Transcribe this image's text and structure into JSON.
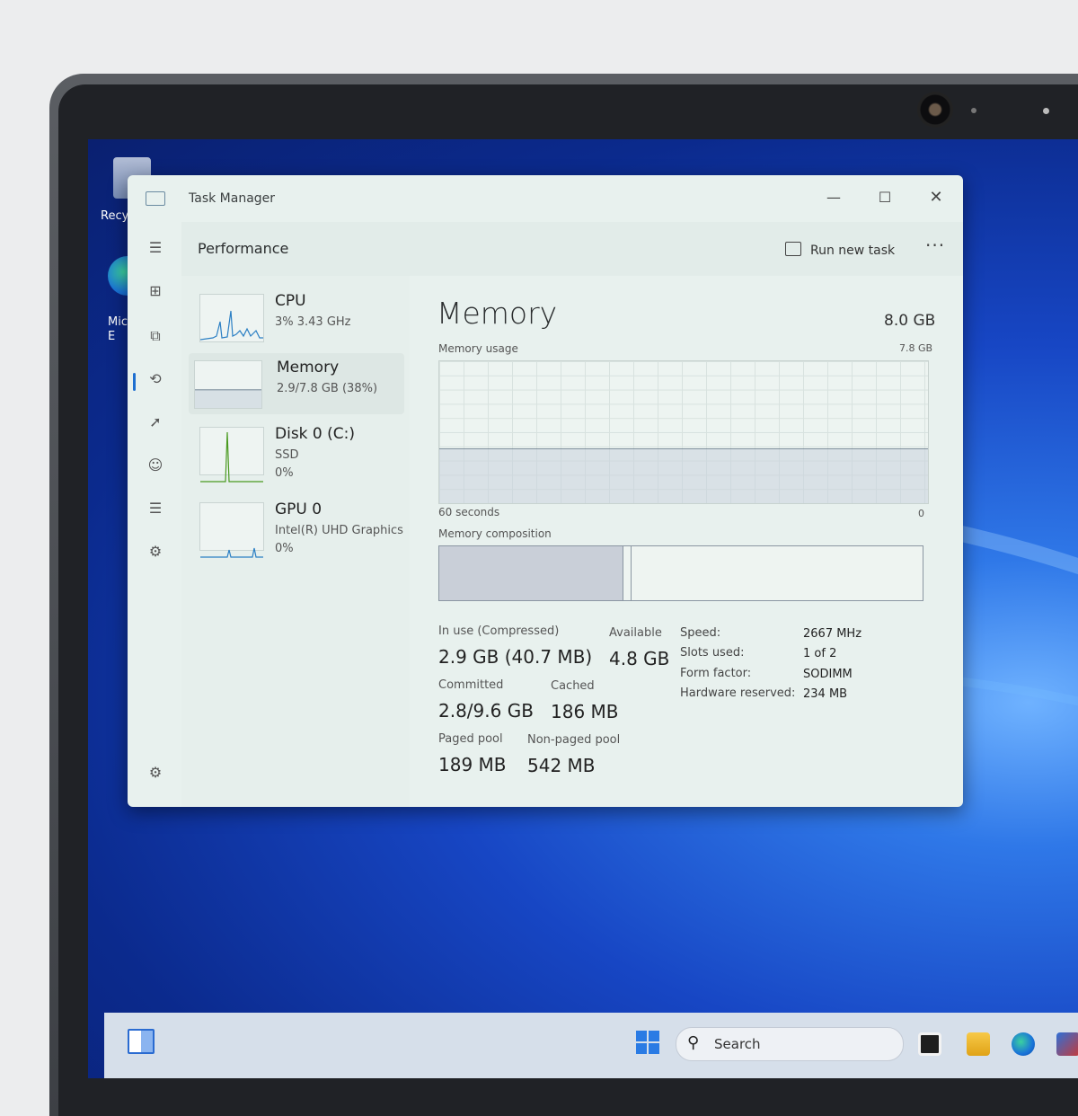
{
  "desktop": {
    "recycle_label": "Recy",
    "edge_label_line1": "Mic",
    "edge_label_line2": "E"
  },
  "window": {
    "title": "Task Manager",
    "minimize": "—",
    "maximize": "☐",
    "close": "✕"
  },
  "header": {
    "title": "Performance",
    "run_new_task": "Run new task",
    "more": "···"
  },
  "nav": {
    "hamburger": "☰",
    "processes": "⊞",
    "performance": "⧉",
    "app_history": "⟲",
    "startup": "➚",
    "users": "☺",
    "details": "☰",
    "services": "⚙",
    "settings": "⚙"
  },
  "perf_list": [
    {
      "name": "CPU",
      "line1": "3% 3.43 GHz",
      "line2": ""
    },
    {
      "name": "Memory",
      "line1": "2.9/7.8 GB (38%)",
      "line2": ""
    },
    {
      "name": "Disk 0 (C:)",
      "line1": "SSD",
      "line2": "0%"
    },
    {
      "name": "GPU 0",
      "line1": "Intel(R) UHD Graphics",
      "line2": "0%"
    }
  ],
  "memory": {
    "title": "Memory",
    "total": "8.0 GB",
    "usage_label": "Memory usage",
    "usage_max": "7.8 GB",
    "seconds_label": "60 seconds",
    "zero_label": "0",
    "composition_label": "Memory composition",
    "usage_fraction": 0.38,
    "in_use_fraction": 0.38,
    "stats": {
      "in_use_label": "In use (Compressed)",
      "in_use_value": "2.9 GB (40.7 MB)",
      "available_label": "Available",
      "available_value": "4.8 GB",
      "committed_label": "Committed",
      "committed_value": "2.8/9.6 GB",
      "cached_label": "Cached",
      "cached_value": "186 MB",
      "paged_label": "Paged pool",
      "paged_value": "189 MB",
      "nonpaged_label": "Non-paged pool",
      "nonpaged_value": "542 MB"
    },
    "details": [
      {
        "label": "Speed:",
        "value": "2667 MHz"
      },
      {
        "label": "Slots used:",
        "value": "1 of 2"
      },
      {
        "label": "Form factor:",
        "value": "SODIMM"
      },
      {
        "label": "Hardware reserved:",
        "value": "234 MB"
      }
    ]
  },
  "taskbar": {
    "search_placeholder": "Search",
    "search_icon": "⚲"
  },
  "colors": {
    "accent": "#1e6fd0",
    "window_bg": "#e8f1ee",
    "cpu_graph": "#2b7fc4",
    "disk_graph": "#4a9a20"
  }
}
